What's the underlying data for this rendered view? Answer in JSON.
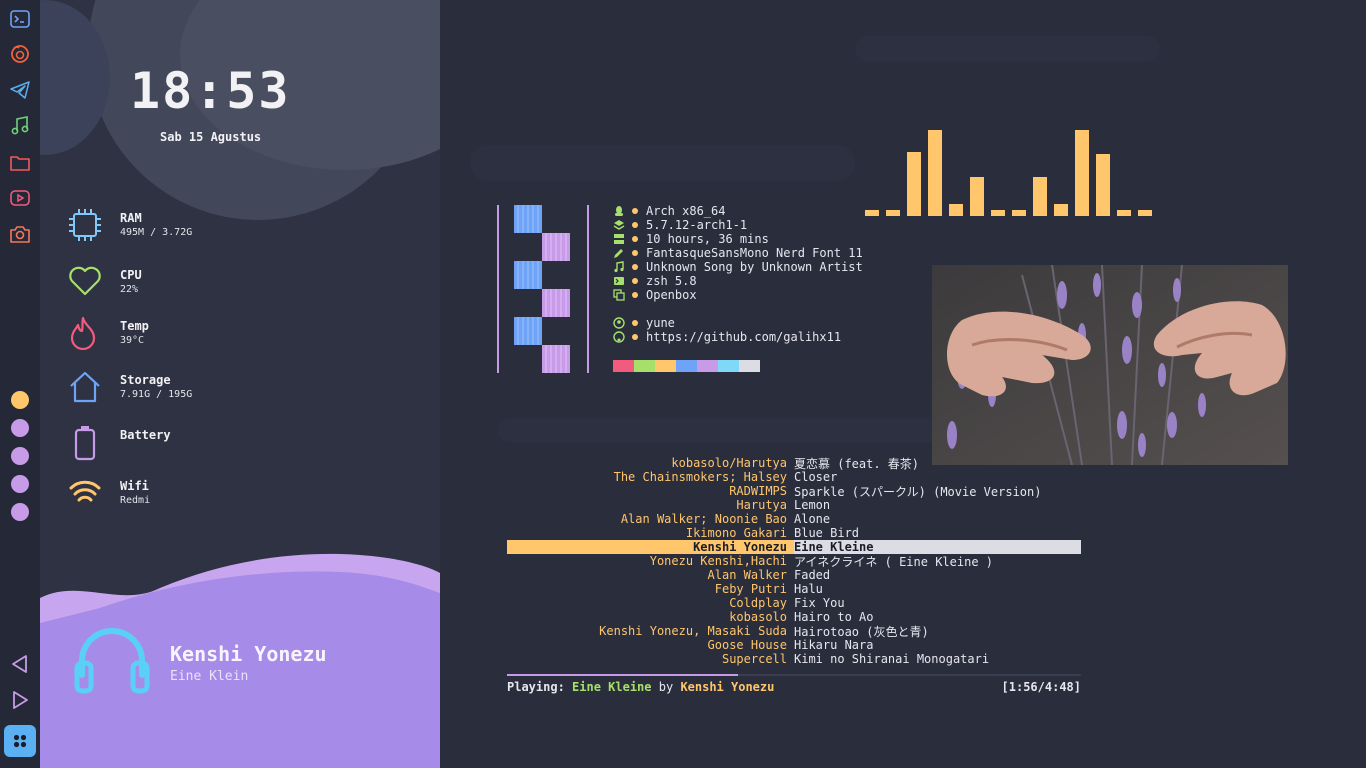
{
  "dock": {
    "icons": [
      "terminal-icon",
      "firefox-icon",
      "telegram-icon",
      "music-note-icon",
      "folder-icon",
      "youtube-icon",
      "camera-icon"
    ],
    "workspace_colors": [
      "#ffc66b",
      "#c79be8",
      "#c79be8",
      "#c79be8",
      "#c79be8"
    ],
    "nav_icons": [
      "previous-icon",
      "play-icon"
    ],
    "launcher_icon": "grid-icon"
  },
  "clock": {
    "time": "18:53",
    "date": "Sab 15 Agustus"
  },
  "stats": [
    {
      "label": "RAM",
      "value": "495M / 3.72G",
      "icon": "chip-icon",
      "color": "#7fc8f8"
    },
    {
      "label": "CPU",
      "value": "22%",
      "icon": "heart-icon",
      "color": "#a6e06a"
    },
    {
      "label": "Temp",
      "value": "39°C",
      "icon": "flame-icon",
      "color": "#f25a7e"
    },
    {
      "label": "Storage",
      "value": "7.91G / 195G",
      "icon": "home-icon",
      "color": "#6fa3f7"
    },
    {
      "label": "Battery",
      "value": "",
      "icon": "battery-icon",
      "color": "#c79be8"
    },
    {
      "label": "Wifi",
      "value": "Redmi",
      "icon": "wifi-icon",
      "color": "#ffc66b"
    }
  ],
  "now_playing": {
    "artist": "Kenshi Yonezu",
    "title": "Eine Klein",
    "icon": "headphones-icon"
  },
  "fetch": {
    "lines": [
      {
        "icon": "linux-icon",
        "text": "Arch x86_64"
      },
      {
        "icon": "layers-icon",
        "text": "5.7.12-arch1-1"
      },
      {
        "icon": "server-icon",
        "text": "10 hours, 36 mins"
      },
      {
        "icon": "pencil-icon",
        "text": "FantasqueSansMono Nerd Font 11"
      },
      {
        "icon": "music-icon",
        "text": "Unknown Song by Unknown Artist"
      },
      {
        "icon": "terminal-icon",
        "text": "zsh 5.8"
      },
      {
        "icon": "windows-icon",
        "text": "Openbox"
      }
    ],
    "user_lines": [
      {
        "icon": "user-icon",
        "text": "yune"
      },
      {
        "icon": "github-icon",
        "text": "https://github.com/galihx11"
      }
    ],
    "palette": [
      "#f25a7e",
      "#a6e06a",
      "#ffc66b",
      "#6fa3f7",
      "#c79be8",
      "#7fd8f8",
      "#dcdce4"
    ]
  },
  "visualizer": {
    "levels": [
      0.07,
      0.07,
      0.74,
      1.0,
      0.14,
      0.45,
      0.07,
      0.07,
      0.45,
      0.14,
      1.0,
      0.72,
      0.07,
      0.07
    ]
  },
  "playlist": [
    {
      "artist": "kobasolo/Harutya",
      "song": "夏恋慕 (feat. 春茶)"
    },
    {
      "artist": "The Chainsmokers; Halsey",
      "song": "Closer"
    },
    {
      "artist": "RADWIMPS",
      "song": "Sparkle (スパークル) (Movie Version)"
    },
    {
      "artist": "Harutya",
      "song": "Lemon"
    },
    {
      "artist": "Alan Walker; Noonie Bao",
      "song": "Alone"
    },
    {
      "artist": "Ikimono Gakari",
      "song": "Blue Bird"
    },
    {
      "artist": "Kenshi Yonezu",
      "song": "Eine Kleine",
      "selected": true
    },
    {
      "artist": "Yonezu Kenshi,Hachi",
      "song": "アイネクライネ ( Eine Kleine )"
    },
    {
      "artist": "Alan Walker",
      "song": "Faded"
    },
    {
      "artist": "Feby Putri",
      "song": "Halu"
    },
    {
      "artist": "Coldplay",
      "song": "Fix You"
    },
    {
      "artist": "kobasolo",
      "song": "Hairo to Ao"
    },
    {
      "artist": "Kenshi Yonezu, Masaki Suda",
      "song": "Hairotoao (灰色と青)"
    },
    {
      "artist": "Goose House",
      "song": "Hikaru Nara"
    },
    {
      "artist": "Supercell",
      "song": "Kimi no Shiranai Monogatari"
    }
  ],
  "player_status": {
    "prefix": "Playing:",
    "song": "Eine Kleine",
    "by": "by",
    "artist": "Kenshi Yonezu",
    "time": "[1:56/4:48]",
    "progress": 0.403
  }
}
